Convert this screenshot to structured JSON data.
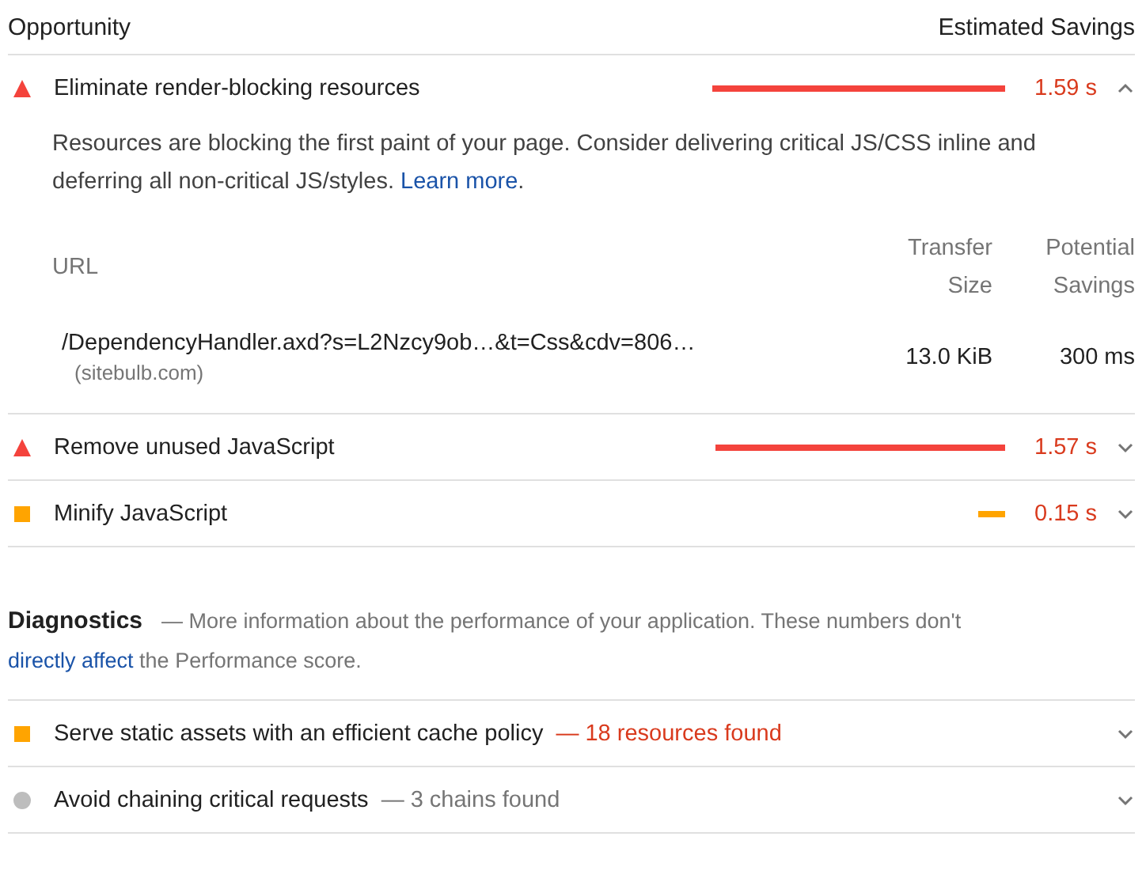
{
  "opportunity_header": {
    "title": "Opportunity",
    "savings_label": "Estimated Savings"
  },
  "opportunities": [
    {
      "kind": "fail",
      "title": "Eliminate render-blocking resources",
      "savings": "1.59 s",
      "expanded": true,
      "details": {
        "description": "Resources are blocking the first paint of your page. Consider delivering critical JS/CSS inline and deferring all non-critical JS/styles.",
        "link": "Learn more",
        "after": ".",
        "table": {
          "columns": [
            "URL",
            "Transfer Size",
            "Potential Savings"
          ],
          "rows": [
            {
              "url": "/DependencyHandler.axd?s=L2Nzcy9ob…&t=Css&cdv=806…",
              "host": "(sitebulb.com)",
              "transfer_size": "13.0 KiB",
              "potential_savings": "300 ms"
            }
          ]
        }
      }
    },
    {
      "kind": "fail",
      "title": "Remove unused JavaScript",
      "savings": "1.57 s",
      "expanded": false
    },
    {
      "kind": "average",
      "title": "Minify JavaScript",
      "savings": "0.15 s",
      "expanded": false
    }
  ],
  "diagnostics": {
    "title": "Diagnostics",
    "description_before": "— More information about the performance of your application. These numbers don't",
    "link": "directly affect",
    "description_after": "the Performance score.",
    "items": [
      {
        "kind": "average",
        "title": "Serve static assets with an efficient cache policy",
        "summary": "— 18 resources found",
        "expanded": false
      },
      {
        "kind": "info",
        "title": "Avoid chaining critical requests",
        "summary": "— 3 chains found",
        "expanded": false
      }
    ]
  }
}
